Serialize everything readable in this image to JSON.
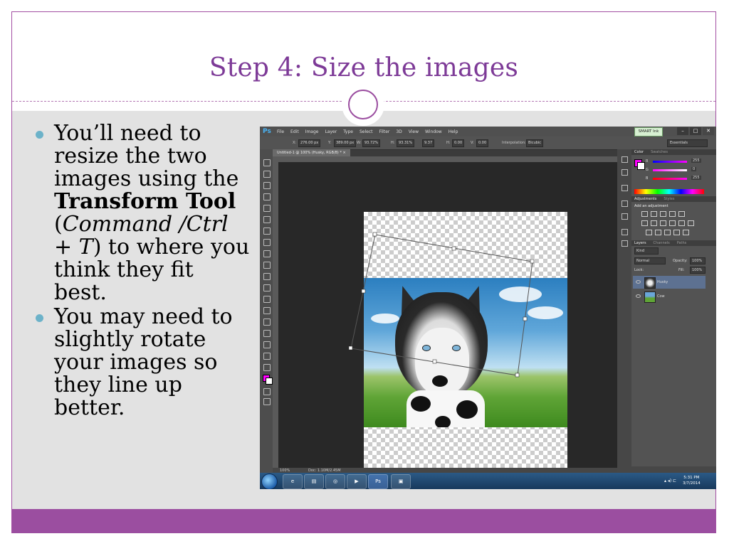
{
  "slide": {
    "title": "Step 4: Size the images",
    "bullets": [
      {
        "runs": [
          {
            "text": "You’ll need to resize the two images using the ",
            "style": "normal"
          },
          {
            "text": "Transform Tool",
            "style": "bold"
          },
          {
            "text": " (",
            "style": "normal"
          },
          {
            "text": "Command /Ctrl + T",
            "style": "italic"
          },
          {
            "text": ") to where you think they fit best.",
            "style": "normal"
          }
        ]
      },
      {
        "runs": [
          {
            "text": "You may need to slightly rotate your images so they line up better.",
            "style": "normal"
          }
        ]
      }
    ],
    "colors": {
      "accent": "#9b4ea0",
      "title": "#7d3a97",
      "bullet": "#6cb2c9",
      "content_bg": "#e2e2e2"
    }
  },
  "screenshot": {
    "app_logo": "Ps",
    "menus": [
      "File",
      "Edit",
      "Image",
      "Layer",
      "Type",
      "Select",
      "Filter",
      "3D",
      "View",
      "Window",
      "Help"
    ],
    "smart_ink": "SMART Ink",
    "window_buttons": [
      "–",
      "□",
      "✕"
    ],
    "options": {
      "x_label": "X:",
      "x_value": "276.00 px",
      "y_label": "Y:",
      "y_value": "389.00 px",
      "w_label": "W:",
      "w_value": "93.72%",
      "h_label": "H:",
      "h_value": "93.31%",
      "angle_value": "9.37",
      "hskew_label": "H:",
      "hskew_value": "0.00",
      "vskew_label": "V:",
      "vskew_value": "0.00",
      "interp_label": "Interpolation:",
      "interp_value": "Bicubic",
      "workspace": "Essentials"
    },
    "doc_tab": "Untitled-1 @ 100% (Husky, RGB/8) *  ×",
    "status": {
      "zoom": "100%",
      "doc_size": "Doc: 1.10M/2.45M"
    },
    "color_panel": {
      "tabs": [
        "Color",
        "Swatches"
      ],
      "channels": [
        "R",
        "G",
        "B"
      ],
      "values": [
        "255",
        "0",
        "255"
      ]
    },
    "adjustments_panel": {
      "tabs": [
        "Adjustments",
        "Styles"
      ],
      "heading": "Add an adjustment"
    },
    "layers_panel": {
      "tabs": [
        "Layers",
        "Channels",
        "Paths"
      ],
      "kind": "Kind",
      "blend_mode": "Normal",
      "opacity_label": "Opacity:",
      "opacity": "100%",
      "lock_label": "Lock:",
      "fill_label": "Fill:",
      "fill": "100%",
      "layers": [
        {
          "name": "Husky",
          "selected": true
        },
        {
          "name": "Cow",
          "selected": false
        }
      ]
    },
    "taskbar": {
      "apps": [
        "e",
        "▤",
        "◎",
        "▶",
        "Ps",
        "▣"
      ],
      "time": "5:31 PM",
      "date": "3/7/2014"
    },
    "fg_color": "#ff00ff",
    "bg_color": "#ffffff"
  }
}
